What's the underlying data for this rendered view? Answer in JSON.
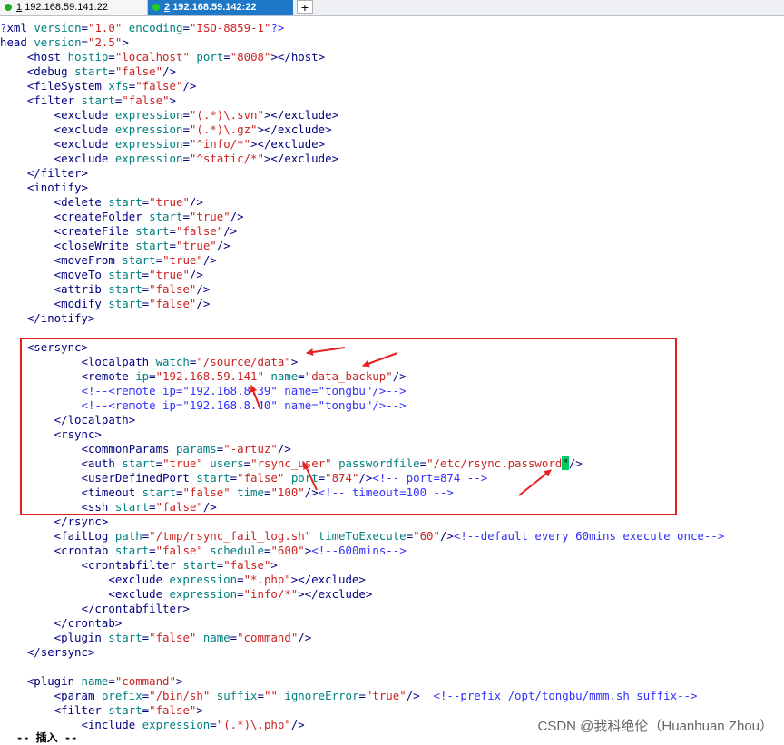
{
  "tabs": [
    {
      "index": "1",
      "host": "192.168.59.141:22",
      "status_color": "#22aa22",
      "active": false
    },
    {
      "index": "2",
      "host": "192.168.59.142:22",
      "status_color": "#22cc22",
      "active": true
    }
  ],
  "new_tab_label": "+",
  "colors": {
    "tag": "#000080",
    "attribute": "#008080",
    "value": "#cc2222",
    "comment": "#3030ff",
    "highlight_box": "#e02020",
    "cursor": "#00cc66",
    "active_tab": "#1e78c8"
  },
  "lines": [
    [
      [
        "c",
        "?"
      ],
      [
        "t",
        "xml "
      ],
      [
        "a",
        "version"
      ],
      [
        "t",
        "="
      ],
      [
        "v",
        "\"1.0\""
      ],
      [
        "t",
        " "
      ],
      [
        "a",
        "encoding"
      ],
      [
        "t",
        "="
      ],
      [
        "v",
        "\"ISO-8859-1\""
      ],
      [
        "c",
        "?>"
      ]
    ],
    [
      [
        "t",
        "head "
      ],
      [
        "a",
        "version"
      ],
      [
        "t",
        "="
      ],
      [
        "v",
        "\"2.5\""
      ],
      [
        "t",
        ">"
      ]
    ],
    [
      [
        "t",
        "    <host "
      ],
      [
        "a",
        "hostip"
      ],
      [
        "t",
        "="
      ],
      [
        "v",
        "\"localhost\""
      ],
      [
        "t",
        " "
      ],
      [
        "a",
        "port"
      ],
      [
        "t",
        "="
      ],
      [
        "v",
        "\"8008\""
      ],
      [
        "t",
        "></host>"
      ]
    ],
    [
      [
        "t",
        "    <debug "
      ],
      [
        "a",
        "start"
      ],
      [
        "t",
        "="
      ],
      [
        "v",
        "\"false\""
      ],
      [
        "t",
        "/>"
      ]
    ],
    [
      [
        "t",
        "    <fileSystem "
      ],
      [
        "a",
        "xfs"
      ],
      [
        "t",
        "="
      ],
      [
        "v",
        "\"false\""
      ],
      [
        "t",
        "/>"
      ]
    ],
    [
      [
        "t",
        "    <filter "
      ],
      [
        "a",
        "start"
      ],
      [
        "t",
        "="
      ],
      [
        "v",
        "\"false\""
      ],
      [
        "t",
        ">"
      ]
    ],
    [
      [
        "t",
        "        <exclude "
      ],
      [
        "a",
        "expression"
      ],
      [
        "t",
        "="
      ],
      [
        "v",
        "\"(.*)\\.svn\""
      ],
      [
        "t",
        "></exclude>"
      ]
    ],
    [
      [
        "t",
        "        <exclude "
      ],
      [
        "a",
        "expression"
      ],
      [
        "t",
        "="
      ],
      [
        "v",
        "\"(.*)\\.gz\""
      ],
      [
        "t",
        "></exclude>"
      ]
    ],
    [
      [
        "t",
        "        <exclude "
      ],
      [
        "a",
        "expression"
      ],
      [
        "t",
        "="
      ],
      [
        "v",
        "\"^info/*\""
      ],
      [
        "t",
        "></exclude>"
      ]
    ],
    [
      [
        "t",
        "        <exclude "
      ],
      [
        "a",
        "expression"
      ],
      [
        "t",
        "="
      ],
      [
        "v",
        "\"^static/*\""
      ],
      [
        "t",
        "></exclude>"
      ]
    ],
    [
      [
        "t",
        "    </filter>"
      ]
    ],
    [
      [
        "t",
        "    <inotify>"
      ]
    ],
    [
      [
        "t",
        "        <delete "
      ],
      [
        "a",
        "start"
      ],
      [
        "t",
        "="
      ],
      [
        "v",
        "\"true\""
      ],
      [
        "t",
        "/>"
      ]
    ],
    [
      [
        "t",
        "        <createFolder "
      ],
      [
        "a",
        "start"
      ],
      [
        "t",
        "="
      ],
      [
        "v",
        "\"true\""
      ],
      [
        "t",
        "/>"
      ]
    ],
    [
      [
        "t",
        "        <createFile "
      ],
      [
        "a",
        "start"
      ],
      [
        "t",
        "="
      ],
      [
        "v",
        "\"false\""
      ],
      [
        "t",
        "/>"
      ]
    ],
    [
      [
        "t",
        "        <closeWrite "
      ],
      [
        "a",
        "start"
      ],
      [
        "t",
        "="
      ],
      [
        "v",
        "\"true\""
      ],
      [
        "t",
        "/>"
      ]
    ],
    [
      [
        "t",
        "        <moveFrom "
      ],
      [
        "a",
        "start"
      ],
      [
        "t",
        "="
      ],
      [
        "v",
        "\"true\""
      ],
      [
        "t",
        "/>"
      ]
    ],
    [
      [
        "t",
        "        <moveTo "
      ],
      [
        "a",
        "start"
      ],
      [
        "t",
        "="
      ],
      [
        "v",
        "\"true\""
      ],
      [
        "t",
        "/>"
      ]
    ],
    [
      [
        "t",
        "        <attrib "
      ],
      [
        "a",
        "start"
      ],
      [
        "t",
        "="
      ],
      [
        "v",
        "\"false\""
      ],
      [
        "t",
        "/>"
      ]
    ],
    [
      [
        "t",
        "        <modify "
      ],
      [
        "a",
        "start"
      ],
      [
        "t",
        "="
      ],
      [
        "v",
        "\"false\""
      ],
      [
        "t",
        "/>"
      ]
    ],
    [
      [
        "t",
        "    </inotify>"
      ]
    ],
    [
      [
        "t",
        ""
      ]
    ],
    [
      [
        "t",
        "    <sersync>"
      ]
    ],
    [
      [
        "t",
        "            <localpath "
      ],
      [
        "a",
        "watch"
      ],
      [
        "t",
        "="
      ],
      [
        "v",
        "\"/source/data\""
      ],
      [
        "t",
        ">"
      ]
    ],
    [
      [
        "t",
        "            <remote "
      ],
      [
        "a",
        "ip"
      ],
      [
        "t",
        "="
      ],
      [
        "v",
        "\"192.168.59.141\""
      ],
      [
        "t",
        " "
      ],
      [
        "a",
        "name"
      ],
      [
        "t",
        "="
      ],
      [
        "v",
        "\"data_backup\""
      ],
      [
        "t",
        "/>"
      ]
    ],
    [
      [
        "c",
        "            <!--<remote ip=\"192.168.8.39\" name=\"tongbu\"/>-->"
      ]
    ],
    [
      [
        "c",
        "            <!--<remote ip=\"192.168.8.40\" name=\"tongbu\"/>-->"
      ]
    ],
    [
      [
        "t",
        "        </localpath>"
      ]
    ],
    [
      [
        "t",
        "        <rsync>"
      ]
    ],
    [
      [
        "t",
        "            <commonParams "
      ],
      [
        "a",
        "params"
      ],
      [
        "t",
        "="
      ],
      [
        "v",
        "\"-artuz\""
      ],
      [
        "t",
        "/>"
      ]
    ],
    [
      [
        "t",
        "            <auth "
      ],
      [
        "a",
        "start"
      ],
      [
        "t",
        "="
      ],
      [
        "v",
        "\"true\""
      ],
      [
        "t",
        " "
      ],
      [
        "a",
        "users"
      ],
      [
        "t",
        "="
      ],
      [
        "v",
        "\"rsync_user\""
      ],
      [
        "t",
        " "
      ],
      [
        "a",
        "passwordfile"
      ],
      [
        "t",
        "="
      ],
      [
        "v",
        "\"/etc/rsync.password"
      ],
      [
        "k",
        "\""
      ],
      [
        "t",
        "/>"
      ]
    ],
    [
      [
        "t",
        "            <userDefinedPort "
      ],
      [
        "a",
        "start"
      ],
      [
        "t",
        "="
      ],
      [
        "v",
        "\"false\""
      ],
      [
        "t",
        " "
      ],
      [
        "a",
        "port"
      ],
      [
        "t",
        "="
      ],
      [
        "v",
        "\"874\""
      ],
      [
        "t",
        "/>"
      ],
      [
        "c",
        "<!-- port=874 -->"
      ]
    ],
    [
      [
        "t",
        "            <timeout "
      ],
      [
        "a",
        "start"
      ],
      [
        "t",
        "="
      ],
      [
        "v",
        "\"false\""
      ],
      [
        "t",
        " "
      ],
      [
        "a",
        "time"
      ],
      [
        "t",
        "="
      ],
      [
        "v",
        "\"100\""
      ],
      [
        "t",
        "/>"
      ],
      [
        "c",
        "<!-- timeout=100 -->"
      ]
    ],
    [
      [
        "t",
        "            <ssh "
      ],
      [
        "a",
        "start"
      ],
      [
        "t",
        "="
      ],
      [
        "v",
        "\"false\""
      ],
      [
        "t",
        "/>"
      ]
    ],
    [
      [
        "t",
        "        </rsync>"
      ]
    ],
    [
      [
        "t",
        "        <failLog "
      ],
      [
        "a",
        "path"
      ],
      [
        "t",
        "="
      ],
      [
        "v",
        "\"/tmp/rsync_fail_log.sh\""
      ],
      [
        "t",
        " "
      ],
      [
        "a",
        "timeToExecute"
      ],
      [
        "t",
        "="
      ],
      [
        "v",
        "\"60\""
      ],
      [
        "t",
        "/>"
      ],
      [
        "c",
        "<!--default every 60mins execute once-->"
      ]
    ],
    [
      [
        "t",
        "        <crontab "
      ],
      [
        "a",
        "start"
      ],
      [
        "t",
        "="
      ],
      [
        "v",
        "\"false\""
      ],
      [
        "t",
        " "
      ],
      [
        "a",
        "schedule"
      ],
      [
        "t",
        "="
      ],
      [
        "v",
        "\"600\""
      ],
      [
        "t",
        ">"
      ],
      [
        "c",
        "<!--600mins-->"
      ]
    ],
    [
      [
        "t",
        "            <crontabfilter "
      ],
      [
        "a",
        "start"
      ],
      [
        "t",
        "="
      ],
      [
        "v",
        "\"false\""
      ],
      [
        "t",
        ">"
      ]
    ],
    [
      [
        "t",
        "                <exclude "
      ],
      [
        "a",
        "expression"
      ],
      [
        "t",
        "="
      ],
      [
        "v",
        "\"*.php\""
      ],
      [
        "t",
        "></exclude>"
      ]
    ],
    [
      [
        "t",
        "                <exclude "
      ],
      [
        "a",
        "expression"
      ],
      [
        "t",
        "="
      ],
      [
        "v",
        "\"info/*\""
      ],
      [
        "t",
        "></exclude>"
      ]
    ],
    [
      [
        "t",
        "            </crontabfilter>"
      ]
    ],
    [
      [
        "t",
        "        </crontab>"
      ]
    ],
    [
      [
        "t",
        "        <plugin "
      ],
      [
        "a",
        "start"
      ],
      [
        "t",
        "="
      ],
      [
        "v",
        "\"false\""
      ],
      [
        "t",
        " "
      ],
      [
        "a",
        "name"
      ],
      [
        "t",
        "="
      ],
      [
        "v",
        "\"command\""
      ],
      [
        "t",
        "/>"
      ]
    ],
    [
      [
        "t",
        "    </sersync>"
      ]
    ],
    [
      [
        "t",
        ""
      ]
    ],
    [
      [
        "t",
        "    <plugin "
      ],
      [
        "a",
        "name"
      ],
      [
        "t",
        "="
      ],
      [
        "v",
        "\"command\""
      ],
      [
        "t",
        ">"
      ]
    ],
    [
      [
        "t",
        "        <param "
      ],
      [
        "a",
        "prefix"
      ],
      [
        "t",
        "="
      ],
      [
        "v",
        "\"/bin/sh\""
      ],
      [
        "t",
        " "
      ],
      [
        "a",
        "suffix"
      ],
      [
        "t",
        "="
      ],
      [
        "v",
        "\"\""
      ],
      [
        "t",
        " "
      ],
      [
        "a",
        "ignoreError"
      ],
      [
        "t",
        "="
      ],
      [
        "v",
        "\"true\""
      ],
      [
        "t",
        "/>  "
      ],
      [
        "c",
        "<!--prefix /opt/tongbu/mmm.sh suffix-->"
      ]
    ],
    [
      [
        "t",
        "        <filter "
      ],
      [
        "a",
        "start"
      ],
      [
        "t",
        "="
      ],
      [
        "v",
        "\"false\""
      ],
      [
        "t",
        ">"
      ]
    ],
    [
      [
        "t",
        "            <include "
      ],
      [
        "a",
        "expression"
      ],
      [
        "t",
        "="
      ],
      [
        "v",
        "\"(.*)\\.php\""
      ],
      [
        "t",
        "/>"
      ]
    ]
  ],
  "bottom_stub": "-- 插入 --",
  "watermark": "CSDN @我科绝伦（Huanhuan Zhou）"
}
